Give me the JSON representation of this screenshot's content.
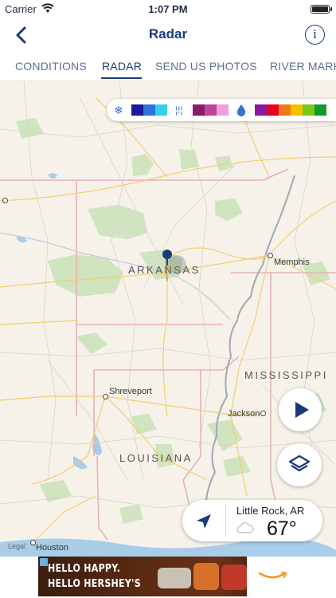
{
  "status_bar": {
    "carrier": "Carrier",
    "time": "1:07 PM"
  },
  "nav": {
    "title": "Radar",
    "back_icon": "chevron-left-icon",
    "info_icon": "info-icon",
    "accent": "#1a3a7a"
  },
  "tabs": [
    {
      "label": "CONDITIONS",
      "active": false
    },
    {
      "label": "RADAR",
      "active": true
    },
    {
      "label": "SEND US PHOTOS",
      "active": false
    },
    {
      "label": "RIVER MARK",
      "active": false
    }
  ],
  "legend": {
    "snow_colors": [
      "#1a1a9e",
      "#2f72d8",
      "#34d0e8"
    ],
    "mix_colors": [
      "#8a1a6a",
      "#c0449a",
      "#f0a0d8"
    ],
    "rain_colors": [
      "#8a1aa0",
      "#e8001c",
      "#f07a1a",
      "#f2c400",
      "#7ac81c",
      "#0f9a2a"
    ]
  },
  "map": {
    "states": [
      "ARKANSAS",
      "MISSISSIPPI",
      "LOUISIANA"
    ],
    "cities": [
      "Memphis",
      "Shreveport",
      "Jackson",
      "Houston"
    ],
    "legal": "Legal"
  },
  "location_card": {
    "name": "Little Rock, AR",
    "temp": "67°",
    "condition_icon": "cloud-icon"
  },
  "ad": {
    "line1": "HELLO HAPPY.",
    "line2": "HELLO HERSHEY'S"
  }
}
